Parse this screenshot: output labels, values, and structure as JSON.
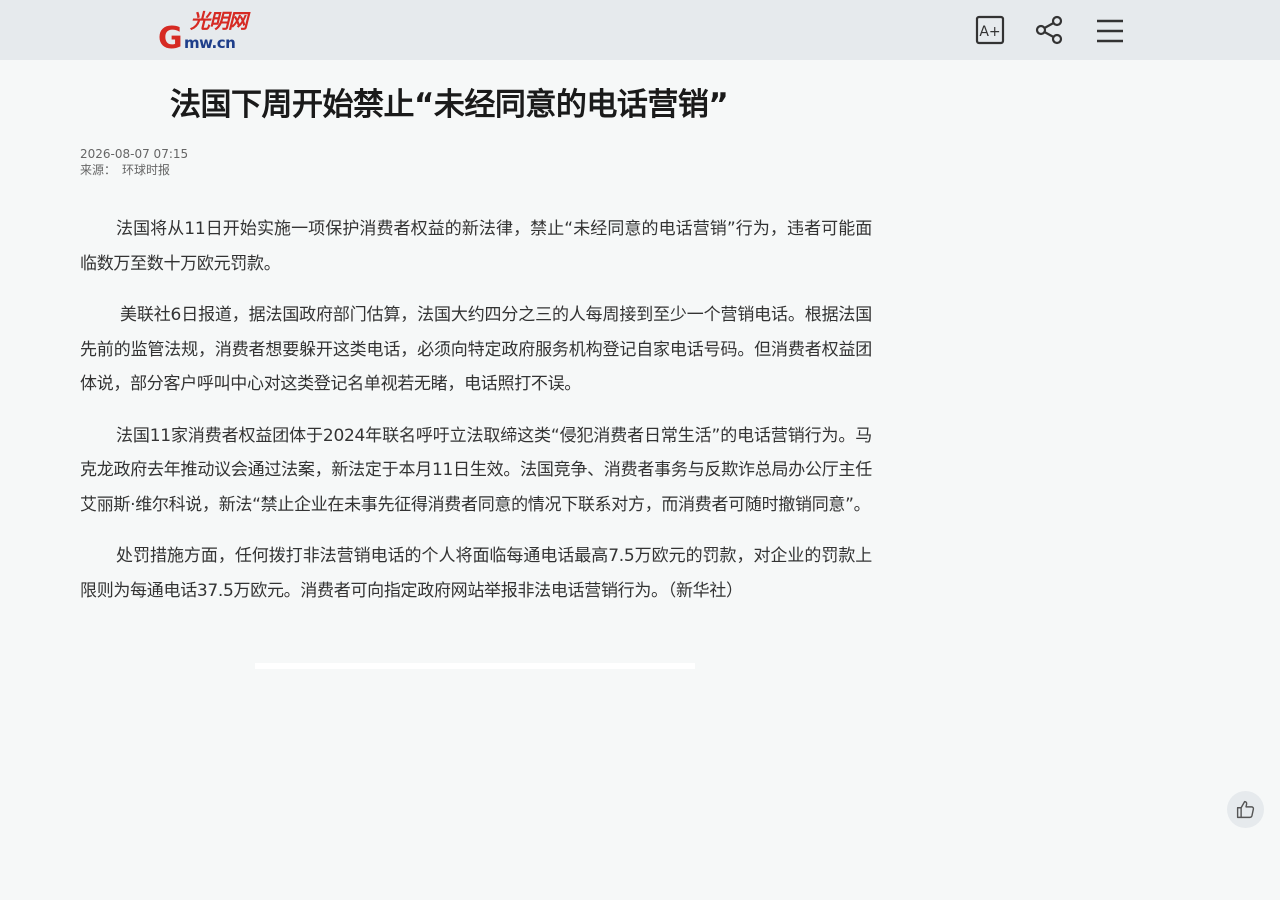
{
  "header": {
    "logo": {
      "letter": "G",
      "script_text": "光明网",
      "domain_text": "mw.cn",
      "brand_red": "#d62a23",
      "brand_blue": "#1e3e8a"
    },
    "tools": [
      {
        "icon": "font-size-increase-icon",
        "label": "A+"
      },
      {
        "icon": "share-icon"
      },
      {
        "icon": "menu-icon"
      }
    ],
    "background": "#e6eaed"
  },
  "article": {
    "title": "法国下周开始禁止“未经同意的电话营销”",
    "date": "2026-08-07 07:15",
    "source_label": "来源：",
    "source": "环球时报",
    "paragraphs": [
      "法国将从11日开始实施一项保护消费者权益的新法律，禁止“未经同意的电话营销”行为，违者可能面临数万至数十万欧元罚款。",
      "美联社6日报道，据法国政府部门估算，法国大约四分之三的人每周接到至少一个营销电话。根据法国先前的监管法规，消费者想要躲开这类电话，必须向特定政府服务机构登记自家电话号码。但消费者权益团体说，部分客户呼叫中心对这类登记名单视若无睹，电话照打不误。",
      "法国11家消费者权益团体于2024年联名呼吁立法取缔这类“侵犯消费者日常生活”的电话营销行为。马克龙政府去年推动议会通过法案，新法定于本月11日生效。法国竞争、消费者事务与反欺诈总局办公厅主任艾丽斯·维尔科说，新法“禁止企业在未事先征得消费者同意的情况下联系对方，而消费者可随时撤销同意”。",
      "处罚措施方面，任何拨打非法营销电话的个人将面临每通电话最高7.5万欧元的罚款，对企业的罚款上限则为每通电话37.5万欧元。消费者可向指定政府网站举报非法电话营销行为。（新华社）"
    ]
  },
  "floating": {
    "like_icon": "thumbs-up-icon"
  }
}
